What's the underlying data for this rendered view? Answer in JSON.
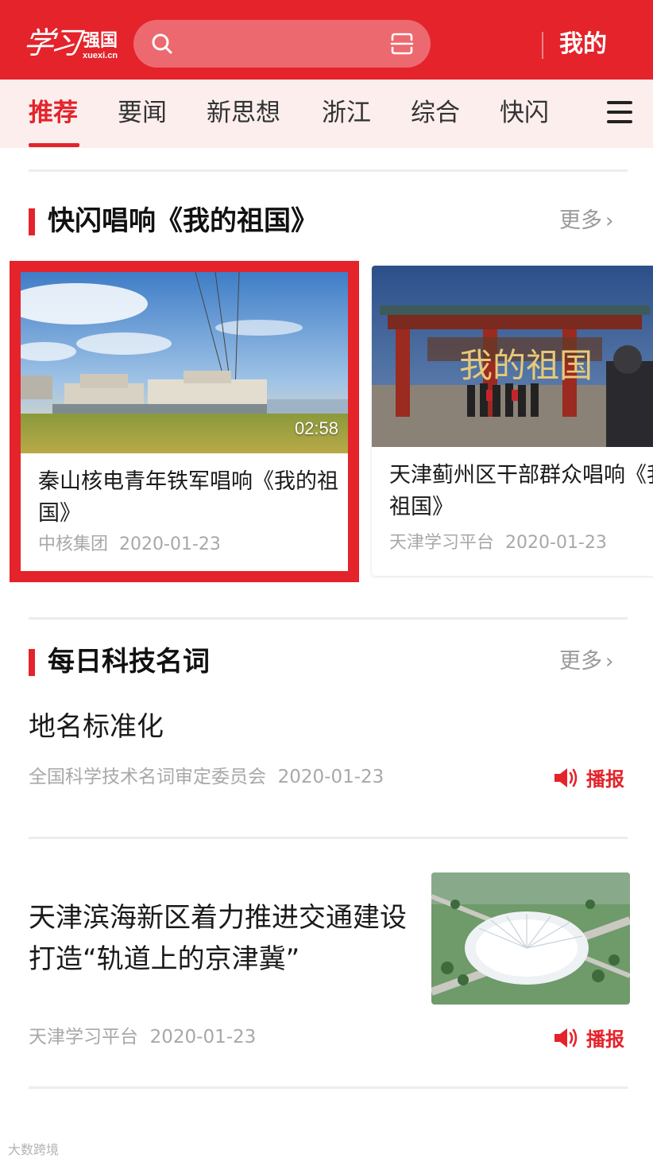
{
  "header": {
    "logo_script": "学习",
    "logo_text": "强国",
    "logo_domain": "xuexi.cn",
    "search_placeholder": "",
    "mine_label": "我的",
    "brand_color": "#e4232b"
  },
  "tabs": [
    {
      "label": "推荐",
      "active": true
    },
    {
      "label": "要闻",
      "active": false
    },
    {
      "label": "新思想",
      "active": false
    },
    {
      "label": "浙江",
      "active": false
    },
    {
      "label": "综合",
      "active": false
    },
    {
      "label": "快闪",
      "active": false
    }
  ],
  "section_video": {
    "title": "快闪唱响《我的祖国》",
    "more_label": "更多",
    "cards": [
      {
        "title": "秦山核电青年铁军唱响《我的祖国》",
        "source": "中核集团",
        "date": "2020-01-23",
        "duration": "02:58"
      },
      {
        "title": "天津蓟州区干部群众唱响《我的祖国》",
        "source": "天津学习平台",
        "date": "2020-01-23",
        "overlay_text": "我的祖国"
      }
    ]
  },
  "section_tech": {
    "title": "每日科技名词",
    "more_label": "更多",
    "word": "地名标准化",
    "source": "全国科学技术名词审定委员会",
    "date": "2020-01-23",
    "broadcast_label": "播报"
  },
  "article": {
    "title": "天津滨海新区着力推进交通建设 打造“轨道上的京津冀”",
    "source": "天津学习平台",
    "date": "2020-01-23",
    "broadcast_label": "播报"
  },
  "watermark": "大数跨境"
}
